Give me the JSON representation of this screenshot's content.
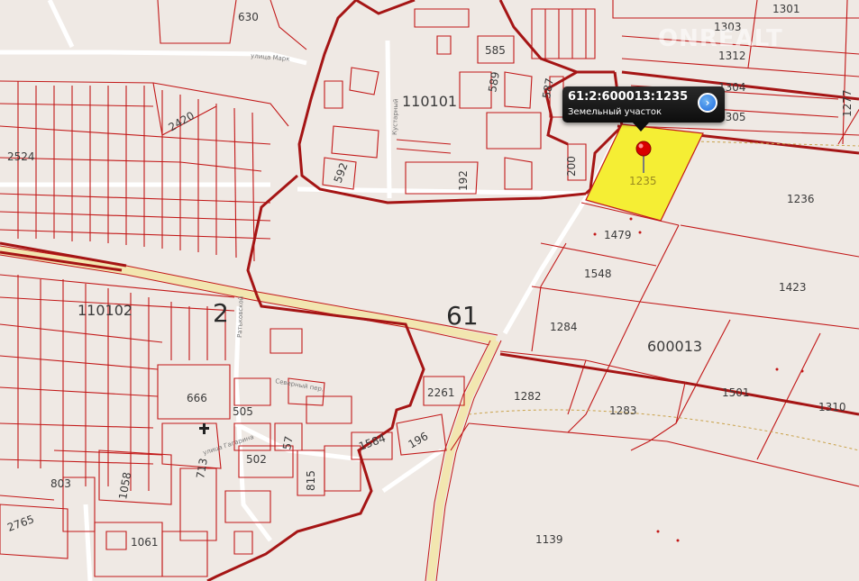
{
  "popup": {
    "cadastral_number": "61:2:600013:1235",
    "type": "Земельный участок"
  },
  "watermark": "ONREALT",
  "labels": {
    "district": "61",
    "zone": "2",
    "quarter_110101": "110101",
    "quarter_110102": "110102",
    "quarter_600013": "600013",
    "selected_parcel": "1235",
    "parcels": [
      "630",
      "1301",
      "1303",
      "1312",
      "1304",
      "1305",
      "1277",
      "585",
      "589",
      "587",
      "2420",
      "2524",
      "592",
      "192",
      "200",
      "1236",
      "1479",
      "1548",
      "1423",
      "1284",
      "1282",
      "1283",
      "1501",
      "1310",
      "666",
      "505",
      "2261",
      "1584",
      "196",
      "502",
      "57",
      "815",
      "713",
      "803",
      "1058",
      "2765",
      "1061",
      "1139"
    ]
  },
  "streets": {
    "marx": "улица Марк",
    "kustar": "Кустарный",
    "severny": "Северный пер.",
    "ratnaya": "Ратьковской",
    "gagarina": "улица Гагарина",
    "generic": "улица"
  },
  "colors": {
    "background": "#efe9e4",
    "boundary": "#c21818",
    "quarter_boundary": "#a51515",
    "selected_fill": "#f5ee34",
    "road": "#f2e6b0",
    "popup_bg": "#111111",
    "pin": "#d90000"
  },
  "icons": {
    "marker": "map-pin-icon",
    "popup_action": "chevron-right-circle-icon",
    "church": "cross-icon"
  }
}
